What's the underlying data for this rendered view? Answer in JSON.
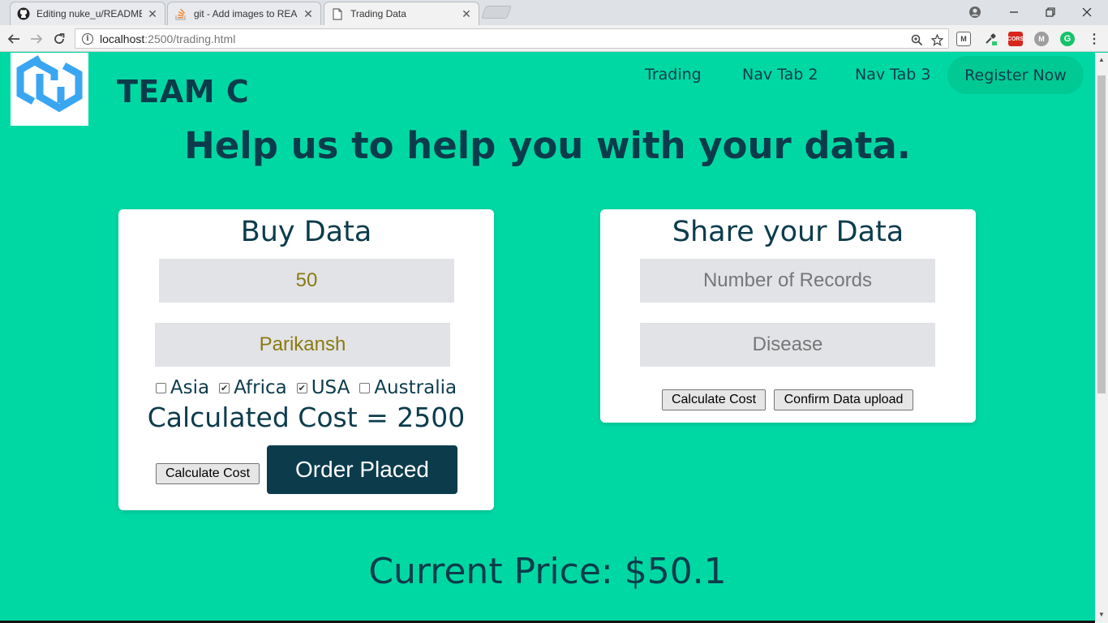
{
  "browser": {
    "tabs": [
      {
        "title": "Editing nuke_u/README",
        "icon": "github-icon"
      },
      {
        "title": "git - Add images to READ",
        "icon": "stackoverflow-icon"
      },
      {
        "title": "Trading Data",
        "icon": "page-icon",
        "active": true
      }
    ],
    "url_host": "localhost",
    "url_path": ":2500/trading.html",
    "extensions": {
      "cors_label": "CORS",
      "m_label": "M",
      "g_label": "G"
    }
  },
  "site": {
    "brand": "TEAM C",
    "nav": [
      "Trading",
      "Nav Tab 2",
      "Nav Tab 3"
    ],
    "register_label": "Register Now",
    "hero": "Help us to help you with your data.",
    "colors": {
      "background": "#00d8a4",
      "primary": "#0c3c4c",
      "register": "#00c994",
      "logo": "#3aa6f2"
    }
  },
  "buy": {
    "title": "Buy Data",
    "quantity_value": "50",
    "name_value": "Parikansh",
    "regions": [
      {
        "label": "Asia",
        "checked": false
      },
      {
        "label": "Africa",
        "checked": true
      },
      {
        "label": "USA",
        "checked": true
      },
      {
        "label": "Australia",
        "checked": false
      }
    ],
    "cost_text": "Calculated Cost = 2500",
    "calc_label": "Calculate Cost",
    "order_label": "Order Placed"
  },
  "share": {
    "title": "Share your Data",
    "records_placeholder": "Number of Records",
    "disease_placeholder": "Disease",
    "calc_label": "Calculate Cost",
    "confirm_label": "Confirm Data upload"
  },
  "price_text": "Current Price: $50.1"
}
